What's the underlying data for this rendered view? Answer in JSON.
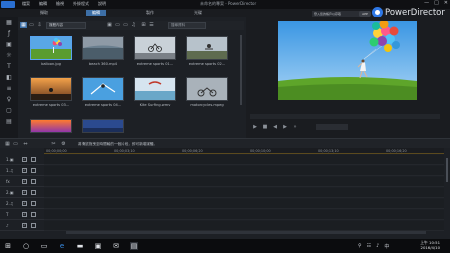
{
  "window": {
    "title": "未命名的專案 - PowerDirector",
    "menu": [
      "檔案",
      "編輯",
      "檢視",
      "外掛程式",
      "說明"
    ],
    "controls": [
      "—",
      "□",
      "✕"
    ]
  },
  "modes": [
    {
      "label": "擷取",
      "active": false
    },
    {
      "label": "編輯",
      "active": true
    },
    {
      "label": "製作",
      "active": false
    },
    {
      "label": "光碟",
      "active": false
    }
  ],
  "account": {
    "signin_text": "登入您的帳戶以存取",
    "app_pill": "APP"
  },
  "brand": {
    "name": "PowerDirector"
  },
  "library": {
    "dropdown": "媒體內容",
    "search_placeholder": "搜尋資料",
    "clips": [
      {
        "name": "balloon.jpg"
      },
      {
        "name": "beach 360.mp4"
      },
      {
        "name": "extreme sports 01..."
      },
      {
        "name": "extreme sports 02..."
      },
      {
        "name": "extreme sports 03..."
      },
      {
        "name": "extreme sports 04..."
      },
      {
        "name": "Kite Surfing.wmv"
      },
      {
        "name": "motorcycles.mpeg"
      },
      {
        "name": ""
      },
      {
        "name": ""
      }
    ]
  },
  "timeline": {
    "hint": "將滑鼠拖曳至時間軸的一個片段，即可新增媒體。",
    "ruler": [
      "00;00;00;00",
      "00;00;03;10",
      "00;00;06;20",
      "00;00;10;00",
      "00;00;13;10",
      "00;00;16;20"
    ],
    "tracks": [
      {
        "num": "1.",
        "icon": "▣"
      },
      {
        "num": "1.",
        "icon": "♫"
      },
      {
        "num": "",
        "icon": "fx"
      },
      {
        "num": "2.",
        "icon": "▣"
      },
      {
        "num": "2.",
        "icon": "♫"
      },
      {
        "num": "",
        "icon": "T"
      },
      {
        "num": "",
        "icon": "♪"
      }
    ]
  },
  "taskbar": {
    "time": "上午 10:51",
    "date": "2016/4/10"
  }
}
